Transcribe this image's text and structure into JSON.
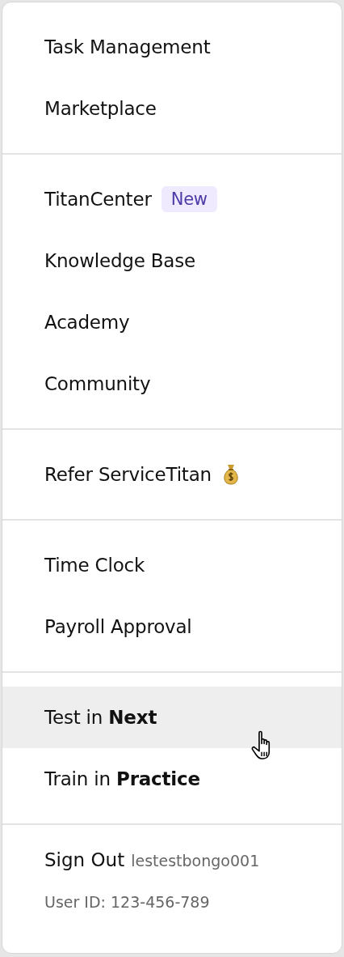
{
  "menu": {
    "sections": [
      {
        "items": [
          {
            "kind": "plain",
            "label": "Task Management",
            "selected": false
          },
          {
            "kind": "plain",
            "label": "Marketplace",
            "selected": false
          }
        ]
      },
      {
        "items": [
          {
            "kind": "badge",
            "label": "TitanCenter",
            "badge": "New",
            "selected": false
          },
          {
            "kind": "plain",
            "label": "Knowledge Base",
            "selected": false
          },
          {
            "kind": "plain",
            "label": "Academy",
            "selected": false
          },
          {
            "kind": "plain",
            "label": "Community",
            "selected": false
          }
        ]
      },
      {
        "items": [
          {
            "kind": "reward",
            "label": "Refer ServiceTitan",
            "selected": false
          }
        ]
      },
      {
        "items": [
          {
            "kind": "plain",
            "label": "Time Clock",
            "selected": false
          },
          {
            "kind": "plain",
            "label": "Payroll Approval",
            "selected": false
          }
        ]
      },
      {
        "items": [
          {
            "kind": "plain",
            "label": "Test in **Next**",
            "selected": true
          },
          {
            "kind": "plain",
            "label": "Train in **Practice**",
            "selected": false
          }
        ]
      }
    ],
    "footer": {
      "sign_out": "Sign Out",
      "username": "lestestbongo001",
      "user_id": "User ID: 123-456-789"
    }
  }
}
